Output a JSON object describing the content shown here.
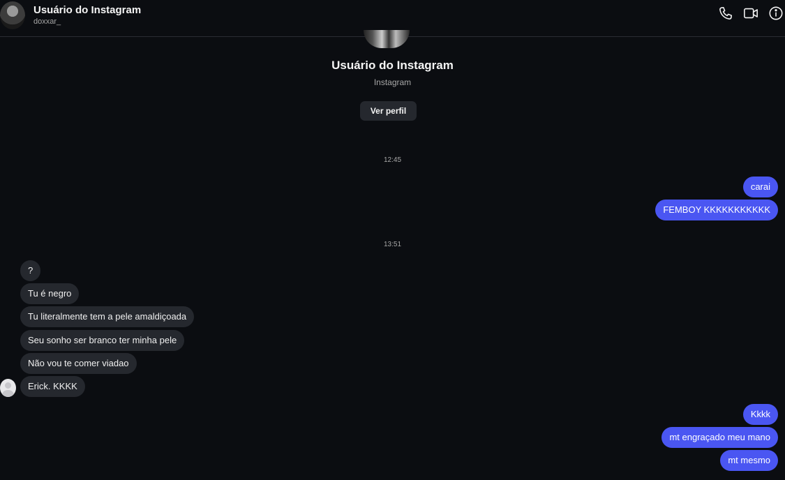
{
  "header": {
    "name": "Usuário do Instagram",
    "username": "doxxar_",
    "icons": [
      "phone-icon",
      "video-camera-icon",
      "info-icon"
    ]
  },
  "profile": {
    "name": "Usuário do Instagram",
    "subtitle": "Instagram",
    "button_label": "Ver perfil"
  },
  "timestamps": [
    "12:45",
    "13:51"
  ],
  "messages_group1": [
    {
      "text": "carai",
      "side": "outgoing"
    },
    {
      "text": "FEMBOY KKKKKKKKKKK",
      "side": "outgoing"
    }
  ],
  "messages_group2": [
    {
      "text": "?",
      "side": "incoming"
    },
    {
      "text": "Tu é negro",
      "side": "incoming"
    },
    {
      "text": "Tu literalmente tem a pele amaldiçoada",
      "side": "incoming"
    },
    {
      "text": "Seu sonho ser branco ter minha pele",
      "side": "incoming"
    },
    {
      "text": "Não vou te comer viadao",
      "side": "incoming"
    },
    {
      "text": "Erick. KKKK",
      "side": "incoming"
    }
  ],
  "messages_group3": [
    {
      "text": "Kkkk",
      "side": "outgoing"
    },
    {
      "text": "mt engraçado meu mano",
      "side": "outgoing"
    },
    {
      "text": "mt mesmo",
      "side": "outgoing"
    }
  ],
  "colors": {
    "background": "#0b0d11",
    "outgoing_bubble": "#4a56f2",
    "incoming_bubble": "#25282e"
  }
}
